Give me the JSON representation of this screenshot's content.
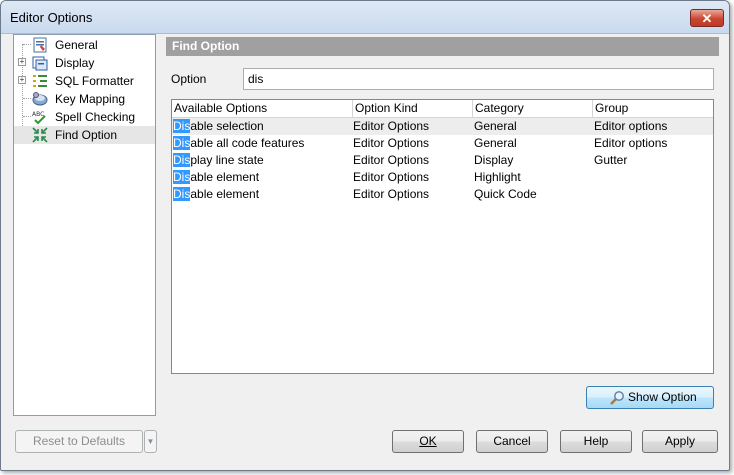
{
  "window": {
    "title": "Editor Options",
    "close_label": "✕"
  },
  "tree": {
    "items": [
      {
        "label": "General",
        "icon": "general-icon",
        "expandable": false
      },
      {
        "label": "Display",
        "icon": "display-icon",
        "expandable": true
      },
      {
        "label": "SQL Formatter",
        "icon": "sql-formatter-icon",
        "expandable": true
      },
      {
        "label": "Key Mapping",
        "icon": "key-mapping-icon",
        "expandable": false
      },
      {
        "label": "Spell Checking",
        "icon": "spell-checking-icon",
        "expandable": false
      },
      {
        "label": "Find Option",
        "icon": "find-option-icon",
        "expandable": false,
        "selected": true
      }
    ]
  },
  "section": {
    "title": "Find Option"
  },
  "option": {
    "label": "Option",
    "value": "dis"
  },
  "grid": {
    "columns": [
      "Available Options",
      "Option Kind",
      "Category",
      "Group"
    ],
    "match_prefix": [
      "Dis",
      "Dis",
      "Dis",
      "Dis",
      "Dis"
    ],
    "rows": [
      {
        "name_rest": "able selection",
        "kind": "Editor Options",
        "category": "General",
        "group": "Editor options"
      },
      {
        "name_rest": "able all code features",
        "kind": "Editor Options",
        "category": "General",
        "group": "Editor options"
      },
      {
        "name_rest": "play line state",
        "kind": "Editor Options",
        "category": "Display",
        "group": "Gutter"
      },
      {
        "name_rest": "able element",
        "kind": "Editor Options",
        "category": "Highlight",
        "group": ""
      },
      {
        "name_rest": "able element",
        "kind": "Editor Options",
        "category": "Quick Code",
        "group": ""
      }
    ]
  },
  "buttons": {
    "show_option": "Show Option",
    "reset": "Reset to Defaults",
    "ok": "OK",
    "cancel": "Cancel",
    "help": "Help",
    "apply": "Apply"
  },
  "colors": {
    "selection": "#3399ff",
    "section_header": "#a0a0a0",
    "close_button": "#c8472f"
  }
}
